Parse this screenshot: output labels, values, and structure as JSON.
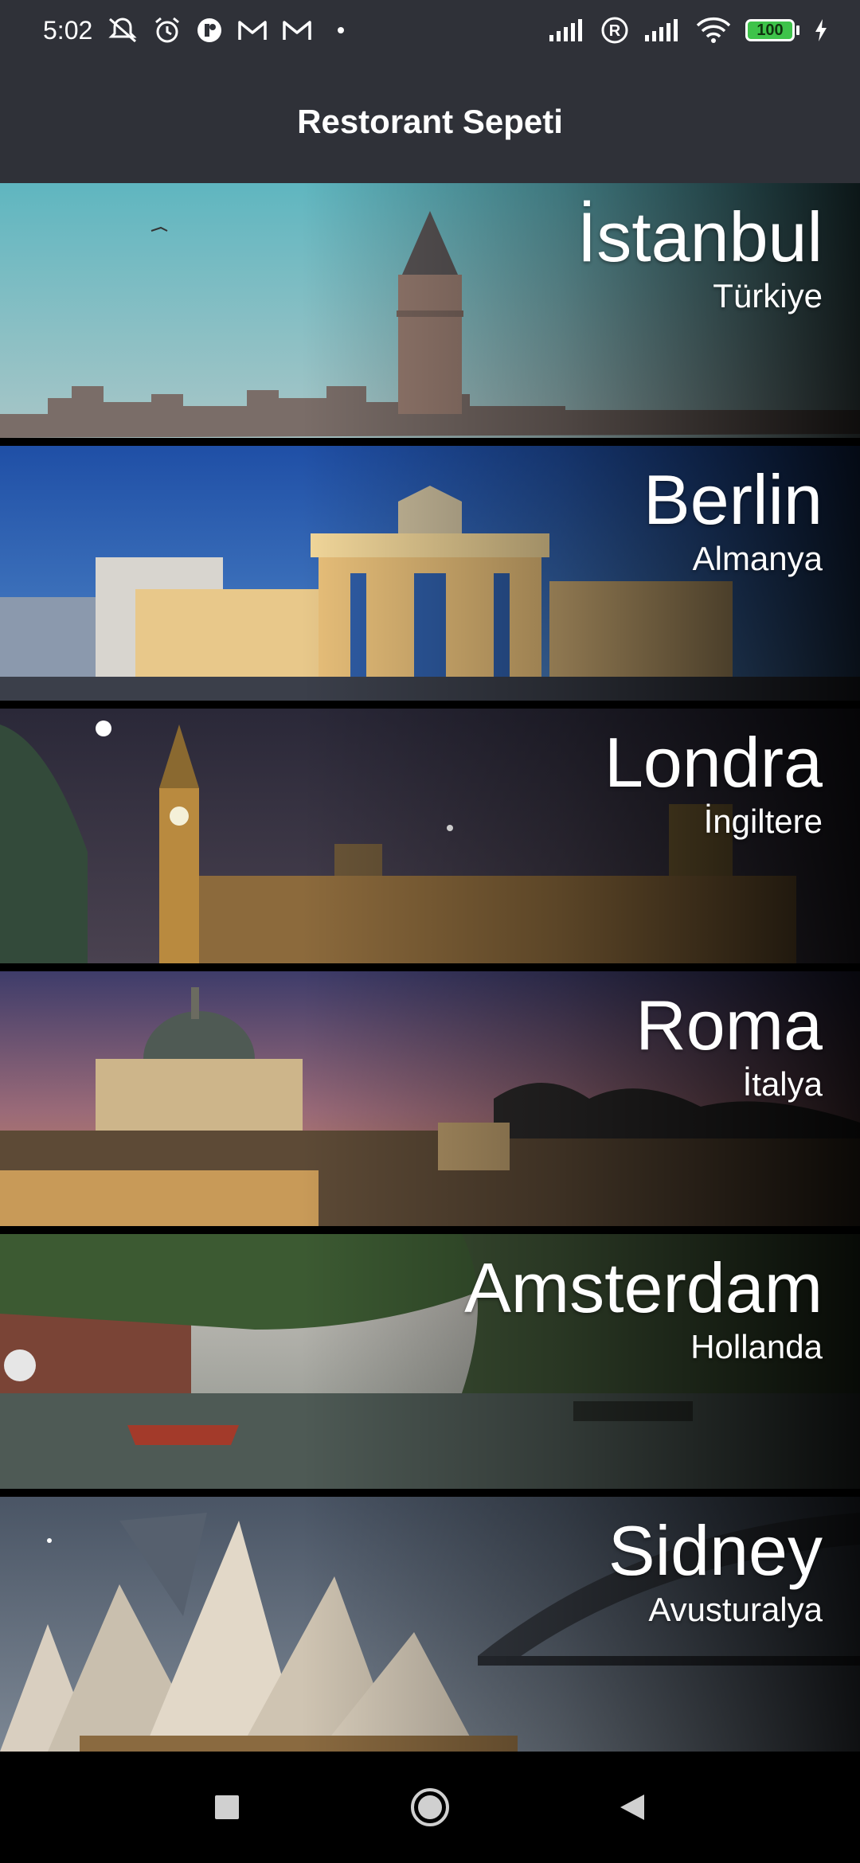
{
  "status_bar": {
    "time": "5:02",
    "left_icons": [
      "muted-icon",
      "alarm-icon",
      "app-icon",
      "gmail-icon",
      "gmail-icon",
      "dot-icon"
    ],
    "right_icons": [
      "signal-icon",
      "roaming-icon",
      "signal-icon",
      "wifi-icon"
    ],
    "battery": "100"
  },
  "app_bar": {
    "title": "Restorant Sepeti"
  },
  "cities": [
    {
      "name": "İstanbul",
      "country": "Türkiye"
    },
    {
      "name": "Berlin",
      "country": "Almanya"
    },
    {
      "name": "Londra",
      "country": "İngiltere"
    },
    {
      "name": "Roma",
      "country": "İtalya"
    },
    {
      "name": "Amsterdam",
      "country": "Hollanda"
    },
    {
      "name": "Sidney",
      "country": "Avusturalya"
    }
  ],
  "nav_bar": {
    "buttons": [
      "recents-icon",
      "home-icon",
      "back-icon"
    ]
  },
  "colors": {
    "app_bar_bg": "#2f3138",
    "battery_fill": "#3ec34a",
    "background": "#000000"
  }
}
